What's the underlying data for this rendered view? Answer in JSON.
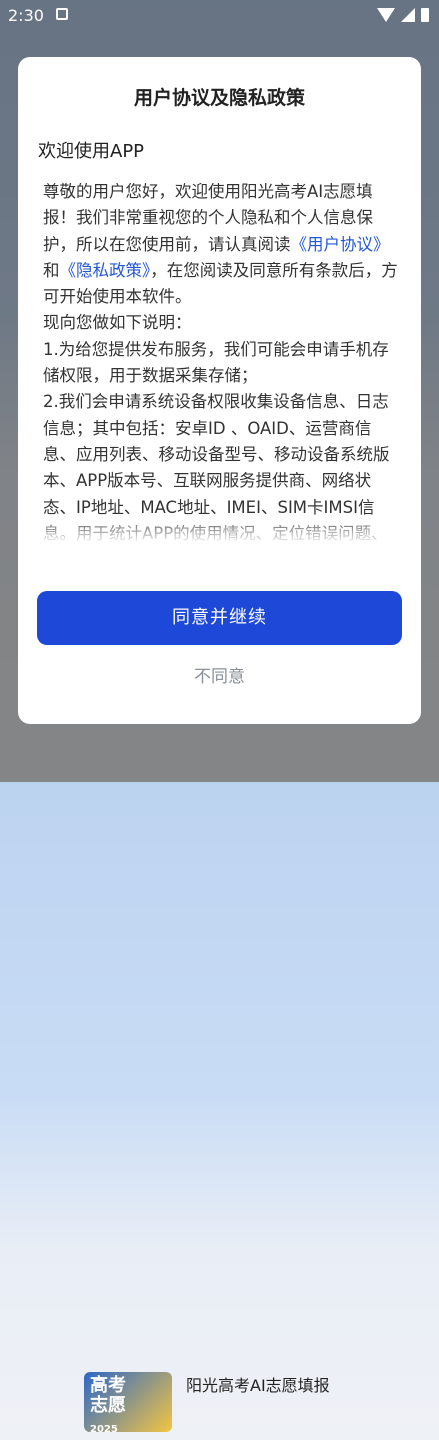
{
  "status_bar": {
    "time": "2:30"
  },
  "background_app": {
    "logo_line1": "高考",
    "logo_line2": "志愿",
    "logo_year": "2025",
    "app_title": "阳光高考AI志愿填报"
  },
  "dialog": {
    "title": "用户协议及隐私政策",
    "welcome": "欢迎使用APP",
    "p1_a": "尊敬的用户您好，欢迎使用阳光高考AI志愿填报！我们非常重视您的个人隐私和个人信息保护，所以在您使用前，请认真阅读",
    "link_user_agreement": "《用户协议》",
    "p1_and": "和",
    "link_privacy_policy": "《隐私政策》",
    "p1_b": "，在您阅读及同意所有条款后，方可开始使用本软件。",
    "p2": "现向您做如下说明：",
    "p3": "1.为给您提供发布服务，我们可能会申请手机存储权限，用于数据采集存储；",
    "p4": "2.我们会申请系统设备权限收集设备信息、日志信息；其中包括：安卓ID 、OAID、运营商信息、应用列表、移动设备型号、移动设备系统版本、APP版本号、互联网服务提供商、网络状态、IP地址、MAC地址、IMEI、SIM卡IMSI信息。用于统计APP的使用情况、定位错误问题、为您提供更加安全的服务。",
    "agree_label": "同意并继续",
    "disagree_label": "不同意"
  }
}
